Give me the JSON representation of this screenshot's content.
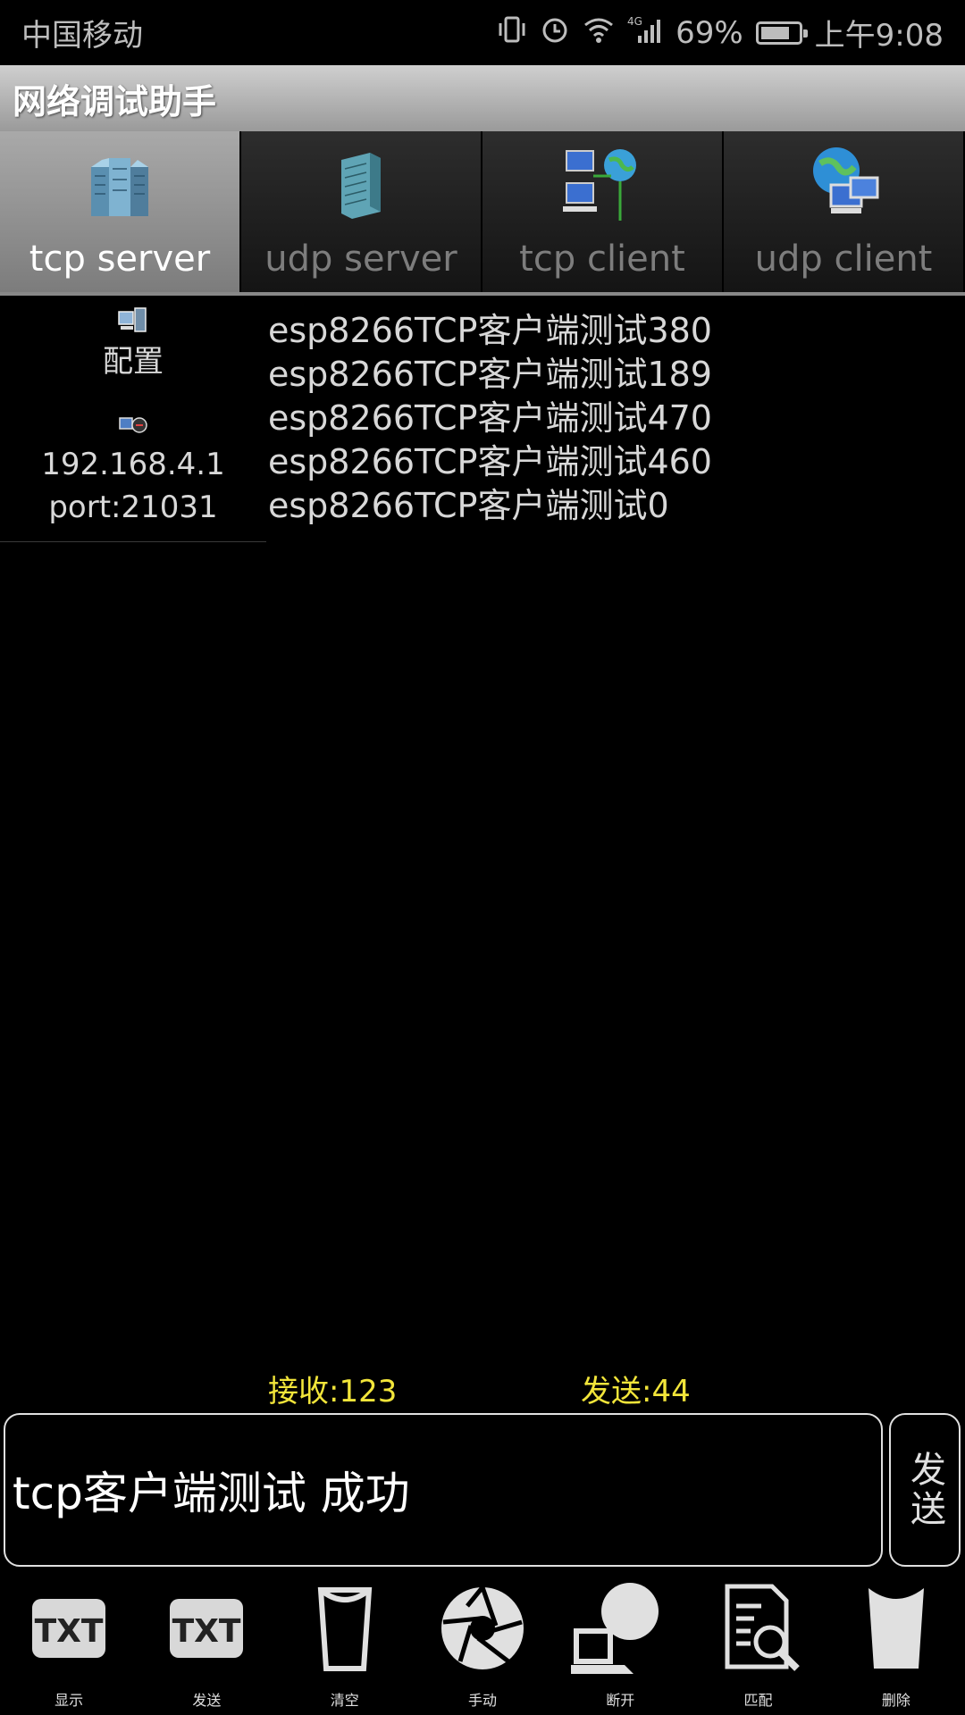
{
  "status_bar": {
    "carrier": "中国移动",
    "network": "4G",
    "battery_percent": "69%",
    "battery_level": 0.69,
    "time": "上午9:08",
    "icons": [
      "vibrate-icon",
      "alarm-icon",
      "wifi-icon",
      "signal-icon",
      "battery-icon"
    ]
  },
  "app": {
    "title": "网络调试助手"
  },
  "tabs": [
    {
      "label": "tcp server",
      "icon": "server-rack-icon",
      "active": true
    },
    {
      "label": "udp server",
      "icon": "server-tower-icon",
      "active": false
    },
    {
      "label": "tcp client",
      "icon": "network-globe-icon",
      "active": false
    },
    {
      "label": "udp client",
      "icon": "globe-computers-icon",
      "active": false
    }
  ],
  "left_panel": {
    "config_label": "配置",
    "ip": "192.168.4.1",
    "port": "port:21031"
  },
  "log": [
    "esp8266TCP客户端测试380",
    "esp8266TCP客户端测试189",
    "esp8266TCP客户端测试470",
    "esp8266TCP客户端测试460",
    "esp8266TCP客户端测试0"
  ],
  "counters": {
    "received": "接收:123",
    "sent": "发送:44"
  },
  "input": {
    "value": "tcp客户端测试 成功"
  },
  "send_button": {
    "label": "发送"
  },
  "toolbar": [
    {
      "label": "显示",
      "icon": "txt-display-icon"
    },
    {
      "label": "发送",
      "icon": "txt-send-icon"
    },
    {
      "label": "清空",
      "icon": "clear-cup-icon"
    },
    {
      "label": "手动",
      "icon": "aperture-icon"
    },
    {
      "label": "断开",
      "icon": "disconnect-laptop-icon"
    },
    {
      "label": "匹配",
      "icon": "search-document-icon"
    },
    {
      "label": "删除",
      "icon": "delete-cup-icon"
    }
  ],
  "colors": {
    "counter_text": "#f2e53a",
    "active_tab": "#9a9a9a",
    "background": "#000000"
  }
}
